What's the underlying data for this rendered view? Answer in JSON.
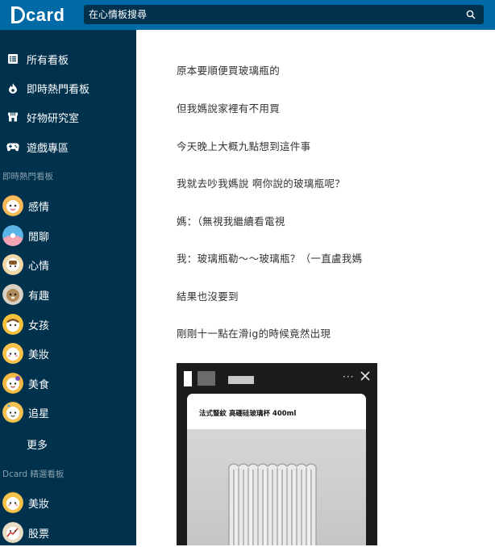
{
  "header": {
    "logo": "card",
    "search_placeholder": "在心情板搜尋"
  },
  "sidebar": {
    "main_items": [
      {
        "label": "所有看板",
        "icon": "list-icon"
      },
      {
        "label": "即時熱門看板",
        "icon": "fire-icon"
      },
      {
        "label": "好物研究室",
        "icon": "shop-icon"
      },
      {
        "label": "遊戲專區",
        "icon": "gamepad-icon"
      }
    ],
    "hot_section": "即時熱門看板",
    "hot_boards": [
      "感情",
      "閒聊",
      "心情",
      "有趣",
      "女孩",
      "美妝",
      "美食",
      "追星"
    ],
    "more": "更多",
    "featured_section": "Dcard 精選看板",
    "featured_boards": [
      "美妝",
      "股票"
    ]
  },
  "post": {
    "paragraphs": [
      "原本要順便買玻璃瓶的",
      "但我媽說家裡有不用買",
      "今天晚上大概九點想到這件事",
      "我就去吵我媽說 啊你說的玻璃瓶呢？",
      "媽：（無視我繼續看電視",
      "我：玻璃瓶勒～～玻璃瓶？（一直盧我媽",
      "結果也沒要到",
      "剛剛十一點在滑ig的時候竟然出現"
    ],
    "image": {
      "dots": "···",
      "product_title": "法式豎紋 高硼硅玻璃杯 400ml"
    }
  },
  "colors": {
    "topbar": "#006aa6",
    "sidebar": "#00324e",
    "search_bg": "#00324e"
  }
}
